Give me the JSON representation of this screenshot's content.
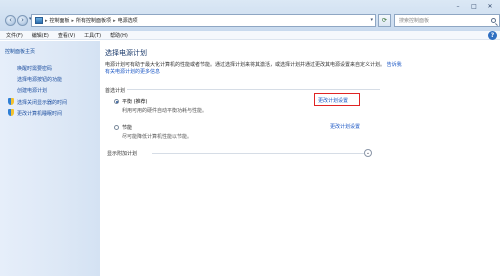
{
  "address": {
    "crumbs": [
      "控制面板",
      "所有控制面板项",
      "电源选项"
    ],
    "search_placeholder": "搜索控制面板"
  },
  "menu": [
    "文件(F)",
    "编辑(E)",
    "查看(V)",
    "工具(T)",
    "帮助(H)"
  ],
  "sidebar": {
    "home": "控制面板主页",
    "links": [
      "唤醒时需要密码",
      "选择电源按钮的功能",
      "创建电源计划",
      "选择关闭显示器的时间",
      "更改计算机睡眠时间"
    ]
  },
  "main": {
    "title": "选择电源计划",
    "description": "电源计划可有助于最大化计算机的性能或者节能。通过选择计划来将其激活，或选择计划并通过更改其电源设置来自定义计划。",
    "description_link": "告诉我有关电源计划的更多信息",
    "group_label": "首选计划",
    "plans": [
      {
        "name": "平衡 (推荐)",
        "desc": "利用可用的硬件自动平衡功耗与性能。",
        "link": "更改计划设置",
        "selected": true
      },
      {
        "name": "节能",
        "desc": "尽可能降低计算机性能以节能。",
        "link": "更改计划设置",
        "selected": false
      }
    ],
    "more_plans": "显示附加计划"
  },
  "colors": {
    "accent_link": "#1a56c4",
    "highlight": "#e02424",
    "title": "#1b3a6b"
  }
}
